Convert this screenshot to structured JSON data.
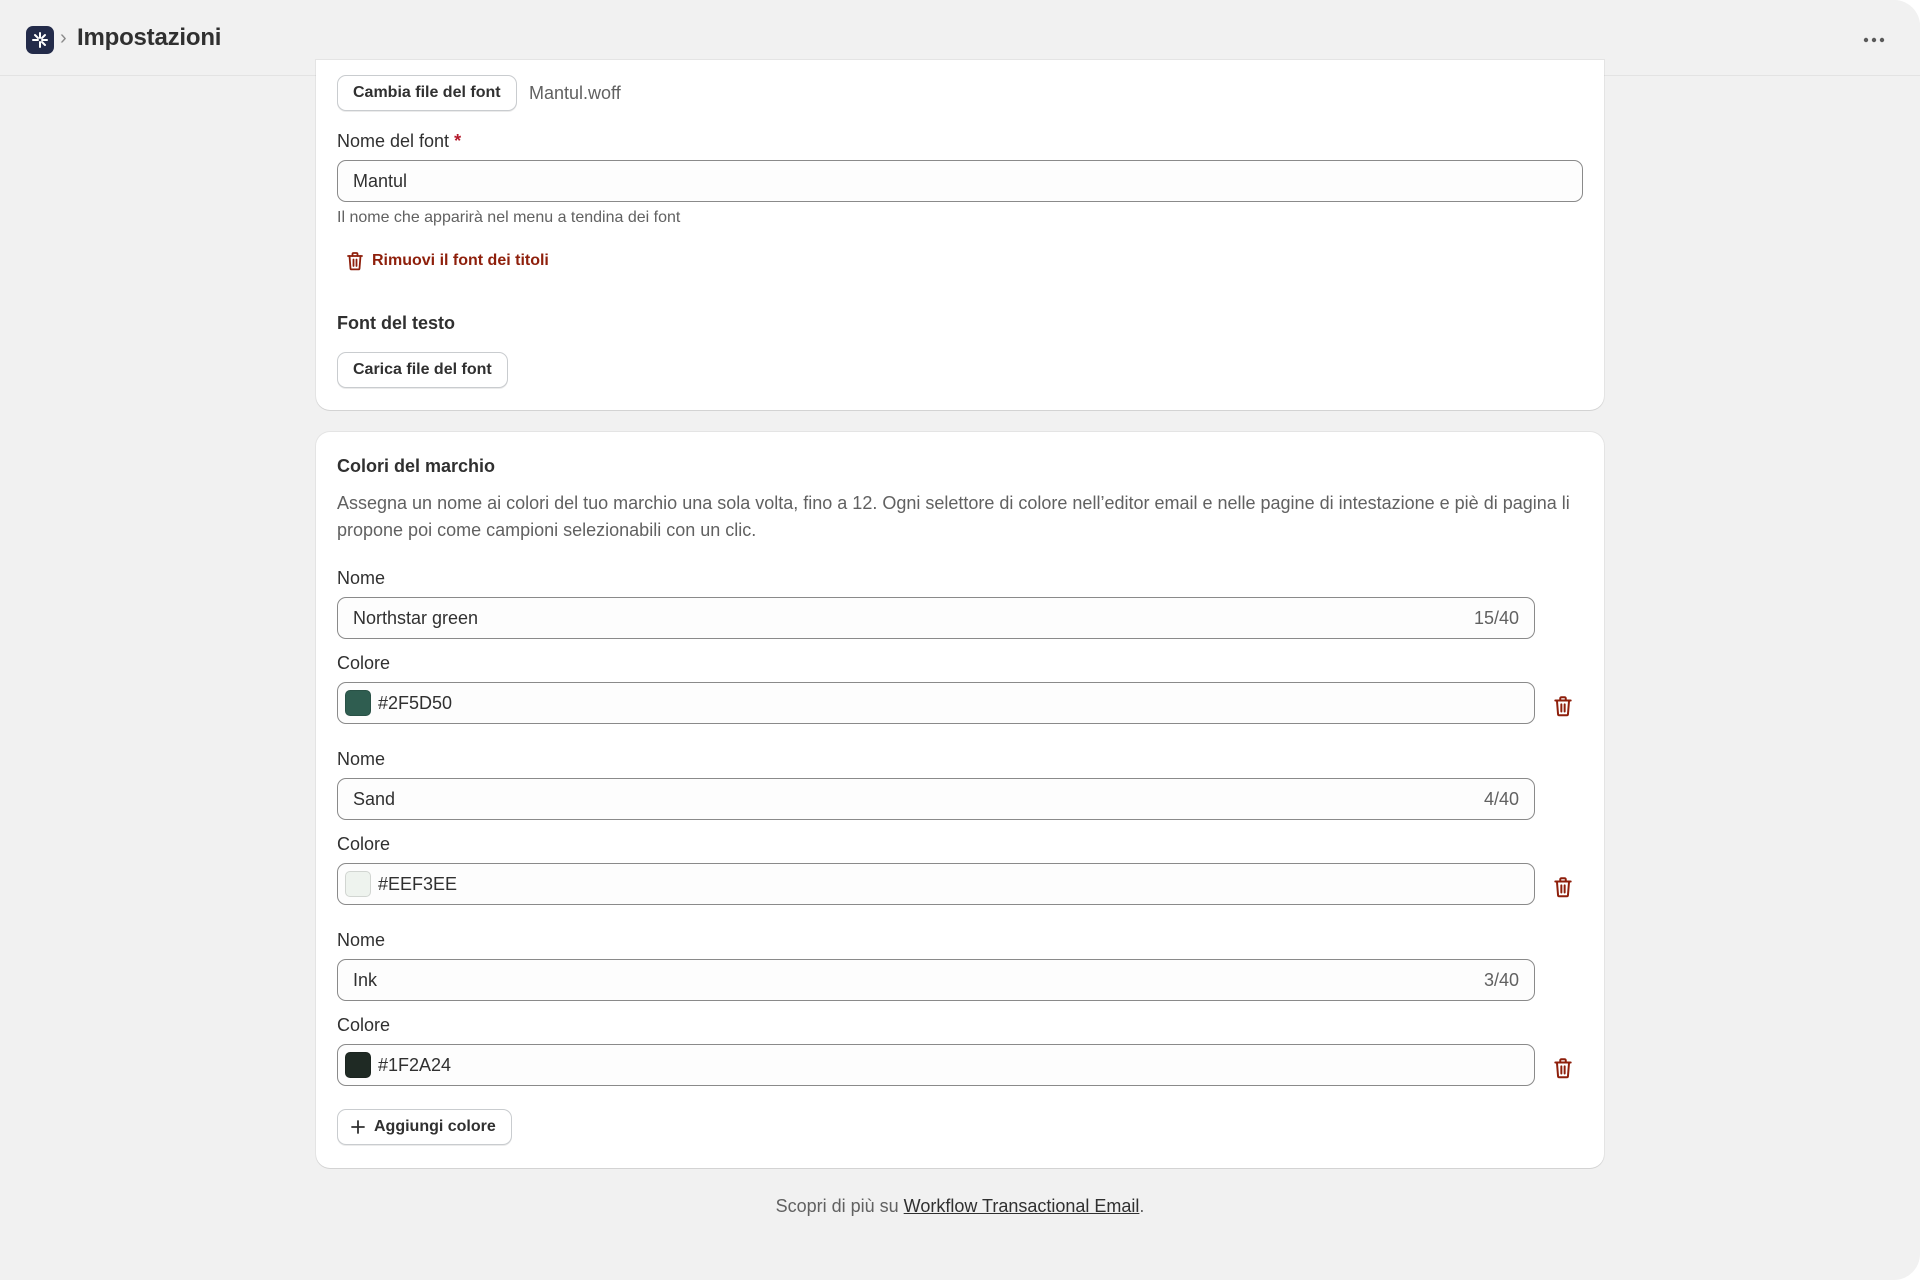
{
  "header": {
    "title": "Impostazioni",
    "breadcrumb_separator": "›",
    "app_icon": "app-logo-icon",
    "more_icon": "horizontal-dots-icon"
  },
  "heading_font": {
    "change_button_label": "Cambia file del font",
    "file_name": "Mantul.woff",
    "name_label": "Nome del font",
    "required_mark": "*",
    "name_value": "Mantul",
    "name_help": "Il nome che apparirà nel menu a tendina dei font",
    "remove_label": "Rimuovi il font dei titoli"
  },
  "body_font": {
    "title": "Font del testo",
    "upload_button_label": "Carica file del font"
  },
  "brand_colors": {
    "title": "Colori del marchio",
    "description": "Assegna un nome ai colori del tuo marchio una sola volta, fino a 12. Ogni selettore di colore nell’editor email e nelle pagine di intestazione e piè di pagina li propone poi come campioni selezionabili con un clic.",
    "name_label": "Nome",
    "color_label": "Colore",
    "items": [
      {
        "name": "Northstar green",
        "counter": "15/40",
        "hex": "#2F5D50"
      },
      {
        "name": "Sand",
        "counter": "4/40",
        "hex": "#EEF3EE"
      },
      {
        "name": "Ink",
        "counter": "3/40",
        "hex": "#1F2A24"
      }
    ],
    "add_button_label": "Aggiungi colore"
  },
  "footer": {
    "prefix": "Scopri di più su ",
    "link_text": "Workflow Transactional Email",
    "suffix": "."
  },
  "colors": {
    "critical": "#8E1F0B",
    "page_background": "#F1F1F1",
    "card_background": "#FFFFFF"
  }
}
